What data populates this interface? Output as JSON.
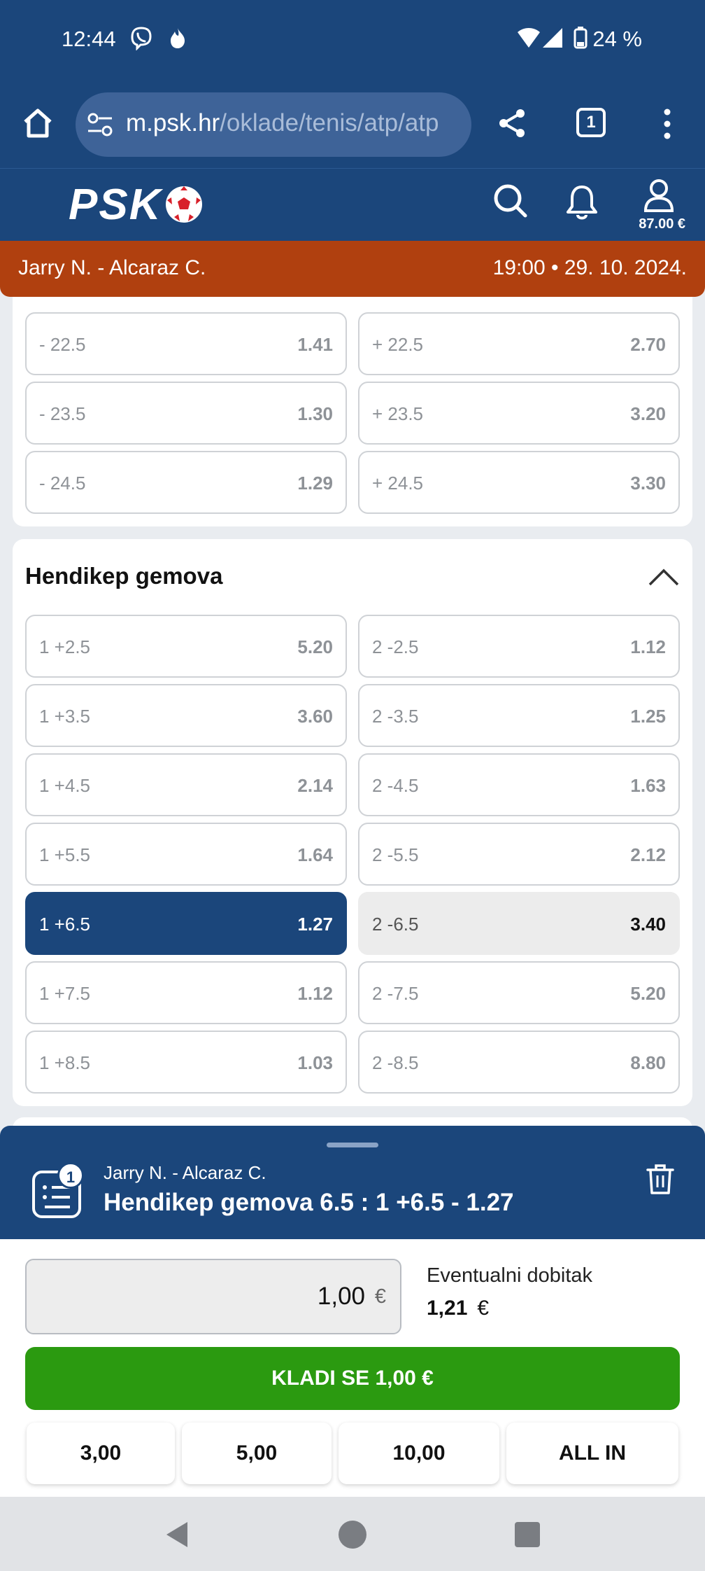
{
  "status_bar": {
    "time": "12:44",
    "battery": "24 %"
  },
  "browser": {
    "url_host": "m.psk.hr",
    "url_path": "/oklade/tenis/atp/atp",
    "tab_count": "1"
  },
  "header": {
    "logo": "PSK",
    "balance": "87.00 €"
  },
  "match_bar": {
    "teams": "Jarry N.  -  Alcaraz C.",
    "datetime": "19:00  •  29. 10. 2024."
  },
  "prev_section": {
    "rows": [
      {
        "left": {
          "label": "- 22.5",
          "odd": "1.41"
        },
        "right": {
          "label": "+ 22.5",
          "odd": "2.70"
        }
      },
      {
        "left": {
          "label": "- 23.5",
          "odd": "1.30"
        },
        "right": {
          "label": "+ 23.5",
          "odd": "3.20"
        }
      },
      {
        "left": {
          "label": "- 24.5",
          "odd": "1.29"
        },
        "right": {
          "label": "+ 24.5",
          "odd": "3.30"
        }
      }
    ]
  },
  "handicap_section": {
    "title": "Hendikep gemova",
    "rows": [
      {
        "left": {
          "label": "1 +2.5",
          "odd": "5.20"
        },
        "right": {
          "label": "2 -2.5",
          "odd": "1.12"
        }
      },
      {
        "left": {
          "label": "1 +3.5",
          "odd": "3.60"
        },
        "right": {
          "label": "2 -3.5",
          "odd": "1.25"
        }
      },
      {
        "left": {
          "label": "1 +4.5",
          "odd": "2.14"
        },
        "right": {
          "label": "2 -4.5",
          "odd": "1.63"
        }
      },
      {
        "left": {
          "label": "1 +5.5",
          "odd": "1.64"
        },
        "right": {
          "label": "2 -5.5",
          "odd": "2.12"
        }
      },
      {
        "left": {
          "label": "1 +6.5",
          "odd": "1.27"
        },
        "right": {
          "label": "2 -6.5",
          "odd": "3.40"
        }
      },
      {
        "left": {
          "label": "1 +7.5",
          "odd": "1.12"
        },
        "right": {
          "label": "2 -7.5",
          "odd": "5.20"
        }
      },
      {
        "left": {
          "label": "1 +8.5",
          "odd": "1.03"
        },
        "right": {
          "label": "2 -8.5",
          "odd": "8.80"
        }
      }
    ]
  },
  "bet_slip": {
    "count": "1",
    "match": "Jarry N. - Alcaraz C.",
    "selection": "Hendikep gemova 6.5 :  1 +6.5 - 1.27",
    "stake": "1,00",
    "currency": "€",
    "potential_win_label": "Eventualni dobitak",
    "potential_win": "1,21",
    "bet_button": "KLADI SE 1,00 €",
    "quick_amounts": [
      "3,00",
      "5,00",
      "10,00",
      "ALL IN"
    ]
  },
  "colors": {
    "primary": "#1b467b",
    "match_bar": "#b0400f",
    "bet_button": "#2b9a10"
  }
}
